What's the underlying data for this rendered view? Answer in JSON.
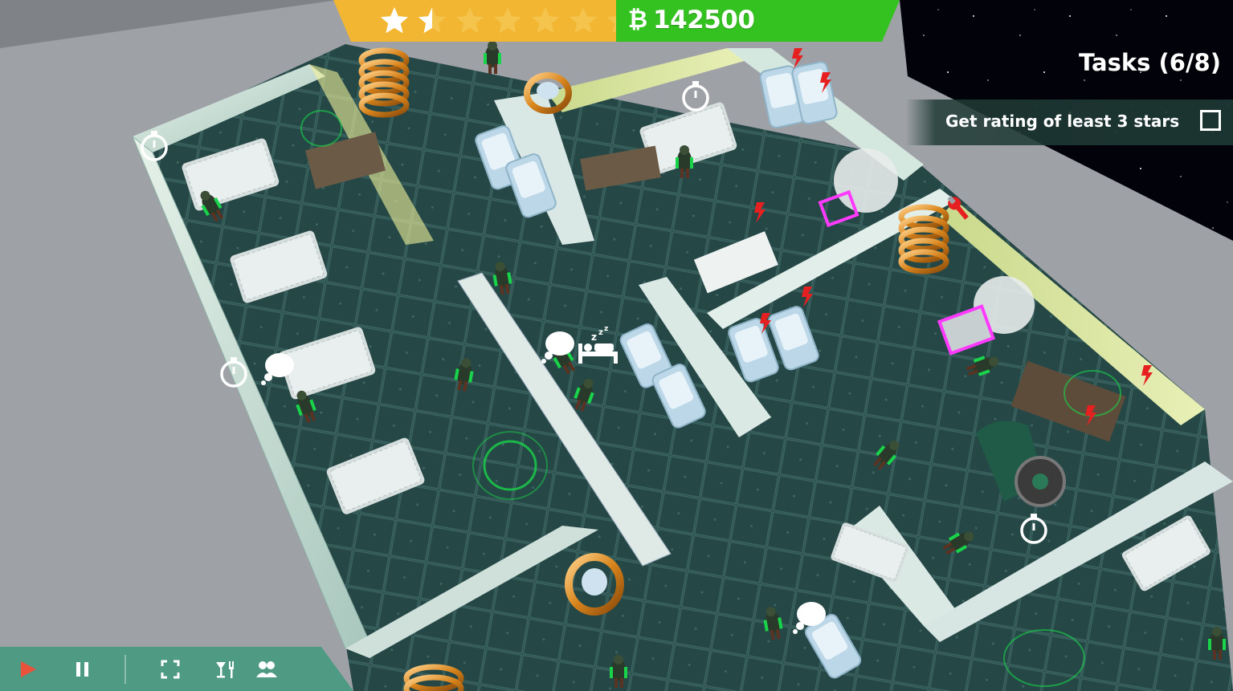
{
  "hud": {
    "rating": {
      "stars_total": 7,
      "stars_filled": 1.5,
      "filled_color": "#ffffff",
      "empty_color": "#f5c44c",
      "background": "#f2b632"
    },
    "money": {
      "currency_icon": "bitcoin-icon",
      "currency_symbol": "₿",
      "amount": "142500",
      "background": "#33c21f"
    },
    "tasks": {
      "title": "Tasks (6/8)",
      "items": [
        {
          "label": "Get rating of least 3 stars",
          "checked": false
        }
      ]
    }
  },
  "controls": {
    "background": "#4f9a82",
    "buttons": [
      {
        "name": "play-icon",
        "active": true,
        "color": "#e8533a"
      },
      {
        "name": "pause-icon",
        "active": false
      },
      {
        "name": "fullscreen-icon"
      },
      {
        "name": "food-drink-icon"
      },
      {
        "name": "people-icon"
      }
    ]
  },
  "map_markers": {
    "power_warning_icon": "lightning-icon",
    "repair_icon": "wrench-icon",
    "sleep_icon": "sleeping-bed-icon",
    "timer_icon": "stopwatch-icon",
    "thought_icon": "thought-bubble-icon",
    "warning_color": "#e62020"
  }
}
